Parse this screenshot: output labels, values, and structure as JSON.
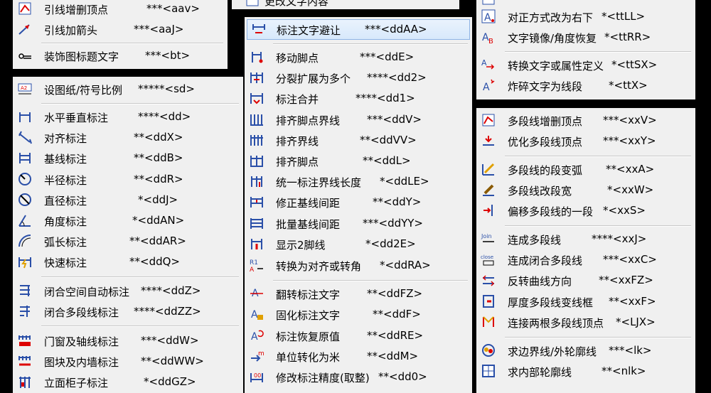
{
  "menus": [
    {
      "id": "m-top-left",
      "items": [
        {
          "label": "引线增删顶点",
          "shortcut": "***<aav>",
          "icon": "leader-edit-vertex-icon"
        },
        {
          "label": "引线加箭头",
          "shortcut": "***<aaJ>",
          "icon": "leader-arrow-icon"
        },
        {
          "label": "装饰图标题文字",
          "shortcut": "***<bt>",
          "icon": "title-decor-icon"
        }
      ]
    },
    {
      "id": "m-left",
      "items": [
        {
          "label": "设图纸/符号比例",
          "shortcut": "*****<sd>",
          "icon": "scale-icon"
        },
        {
          "label": "水平垂直标注",
          "shortcut": "****<dd>",
          "icon": "dim-linear-icon"
        },
        {
          "label": "对齐标注",
          "shortcut": "**<ddX>",
          "icon": "dim-aligned-icon"
        },
        {
          "label": "基线标注",
          "shortcut": "**<ddB>",
          "icon": "dim-baseline-icon"
        },
        {
          "label": "半径标注",
          "shortcut": "**<ddR>",
          "icon": "dim-radius-icon"
        },
        {
          "label": "直径标注",
          "shortcut": "*<ddJ>",
          "icon": "dim-diameter-icon"
        },
        {
          "label": "角度标注",
          "shortcut": "*<ddAN>",
          "icon": "dim-angle-icon"
        },
        {
          "label": "弧长标注",
          "shortcut": "**<ddAR>",
          "icon": "dim-arc-icon"
        },
        {
          "label": "快速标注",
          "shortcut": "**<ddQ>",
          "icon": "dim-quick-icon"
        },
        {
          "label": "闭合空间自动标注",
          "shortcut": "****<ddZ>",
          "icon": "dim-auto-space-icon"
        },
        {
          "label": "闭合多段线标注",
          "shortcut": "****<ddZZ>",
          "icon": "dim-polyline-icon"
        },
        {
          "label": "门窗及轴线标注",
          "shortcut": "***<ddW>",
          "icon": "dim-door-axis-icon"
        },
        {
          "label": "图块及内墙标注",
          "shortcut": "**<ddWW>",
          "icon": "dim-block-wall-icon"
        },
        {
          "label": "立面柜子标注",
          "shortcut": "*<ddGZ>",
          "icon": "dim-cabinet-icon"
        }
      ]
    },
    {
      "id": "m-middle-top",
      "items": [
        {
          "label": "更改文字内容",
          "shortcut": "",
          "icon": "edit-text-icon"
        }
      ]
    },
    {
      "id": "m-middle",
      "items": [
        {
          "label": "标注文字避让",
          "shortcut": "***<ddAA>",
          "icon": "dim-text-avoid-icon"
        },
        {
          "label": "移动脚点",
          "shortcut": "***<ddE>",
          "icon": "move-foot-icon"
        },
        {
          "label": "分裂扩展为多个",
          "shortcut": "****<dd2>",
          "icon": "split-dim-icon"
        },
        {
          "label": "标注合并",
          "shortcut": "****<dd1>",
          "icon": "merge-dim-icon"
        },
        {
          "label": "排齐脚点界线",
          "shortcut": "***<ddV>",
          "icon": "align-foot-ext-icon"
        },
        {
          "label": "排齐界线",
          "shortcut": "**<ddVV>",
          "icon": "align-ext-icon"
        },
        {
          "label": "排齐脚点",
          "shortcut": "**<ddL>",
          "icon": "align-foot-icon"
        },
        {
          "label": "统一标注界线长度",
          "shortcut": "*<ddLE>",
          "icon": "unify-ext-length-icon"
        },
        {
          "label": "修正基线间距",
          "shortcut": "**<ddY>",
          "icon": "fix-baseline-gap-icon"
        },
        {
          "label": "批量基线间距",
          "shortcut": "***<ddYY>",
          "icon": "batch-baseline-gap-icon"
        },
        {
          "label": "显示2脚线",
          "shortcut": "*<dd2E>",
          "icon": "show-two-ext-icon"
        },
        {
          "label": "转换为对齐或转角",
          "shortcut": "*<ddRA>",
          "icon": "convert-aligned-icon"
        },
        {
          "label": "翻转标注文字",
          "shortcut": "**<ddFZ>",
          "icon": "flip-dim-text-icon"
        },
        {
          "label": "固化标注文字",
          "shortcut": "**<ddF>",
          "icon": "fix-dim-text-icon"
        },
        {
          "label": "标注恢复原值",
          "shortcut": "**<ddRE>",
          "icon": "restore-dim-icon"
        },
        {
          "label": "单位转化为米",
          "shortcut": "**<ddM>",
          "icon": "unit-meter-icon"
        },
        {
          "label": "修改标注精度(取整)",
          "shortcut": "**<dd0>",
          "icon": "dim-precision-icon"
        }
      ]
    },
    {
      "id": "m-right-top",
      "items": [
        {
          "label": "对正方式改为右下",
          "shortcut": "*<ttLL>",
          "icon": "text-justify-icon"
        },
        {
          "label": "文字镜像/角度恢复",
          "shortcut": "*<ttRR>",
          "icon": "text-mirror-icon"
        },
        {
          "label": "转换文字或属性定义",
          "shortcut": "*<ttSX>",
          "icon": "text-convert-icon"
        },
        {
          "label": "炸碎文字为线段",
          "shortcut": "*<ttX>",
          "icon": "text-explode-icon"
        }
      ]
    },
    {
      "id": "m-right",
      "items": [
        {
          "label": "多段线增删顶点",
          "shortcut": "***<xxV>",
          "icon": "pline-edit-vertex-icon"
        },
        {
          "label": "优化多段线顶点",
          "shortcut": "***<xxY>",
          "icon": "pline-optimize-icon"
        },
        {
          "label": "多段线的段变弧",
          "shortcut": "**<xxA>",
          "icon": "pline-arc-icon"
        },
        {
          "label": "多段线改段宽",
          "shortcut": "*<xxW>",
          "icon": "pline-width-icon"
        },
        {
          "label": "偏移多段线的一段",
          "shortcut": "*<xxS>",
          "icon": "pline-offset-icon"
        },
        {
          "label": "连成多段线",
          "shortcut": "****<xxJ>",
          "icon": "join-icon"
        },
        {
          "label": "连成闭合多段线",
          "shortcut": "***<xxC>",
          "icon": "close-icon"
        },
        {
          "label": "反转曲线方向",
          "shortcut": "**<xxFZ>",
          "icon": "reverse-curve-icon"
        },
        {
          "label": "厚度多段线变线框",
          "shortcut": "**<xxF>",
          "icon": "thick-pline-icon"
        },
        {
          "label": "连接两根多段线顶点",
          "shortcut": "*<LJX>",
          "icon": "connect-pline-icon"
        },
        {
          "label": "求边界线/外轮廓线",
          "shortcut": "***<lk>",
          "icon": "boundary-icon"
        },
        {
          "label": "求内部轮廓线",
          "shortcut": "**<nlk>",
          "icon": "inner-contour-icon"
        }
      ]
    }
  ]
}
